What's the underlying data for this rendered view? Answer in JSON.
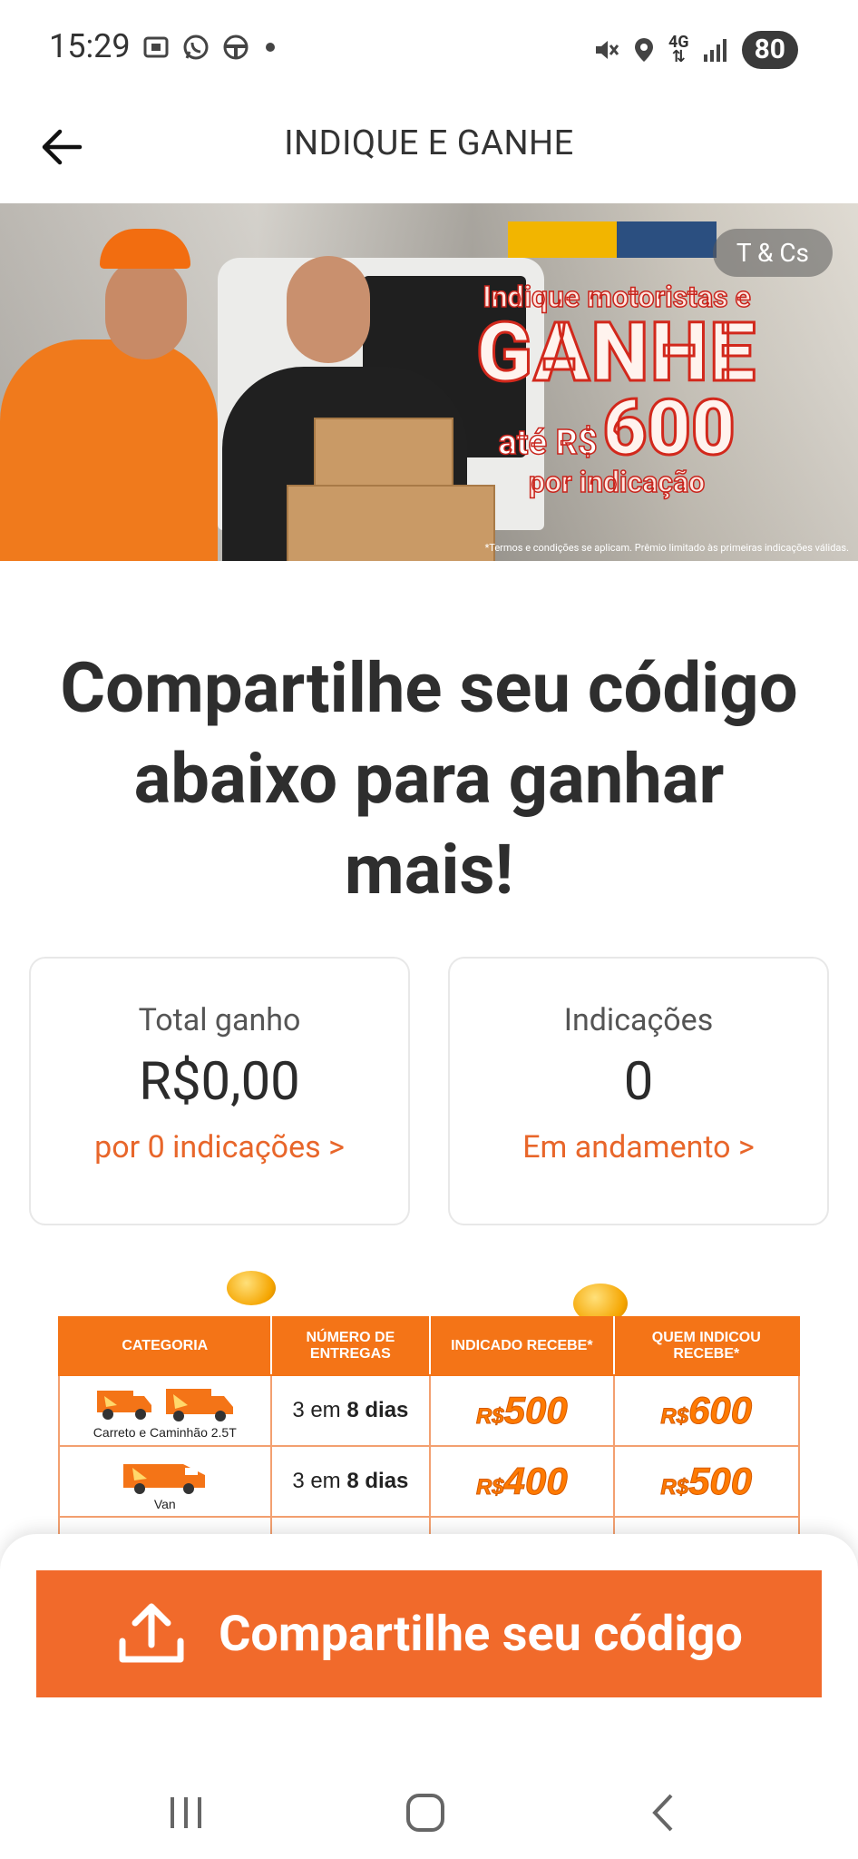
{
  "status_bar": {
    "time": "15:29",
    "battery": "80",
    "network": "4G",
    "left_icons": [
      "screenshot-icon",
      "whatsapp-icon",
      "steering-wheel-icon",
      "dot-icon"
    ],
    "right_icons": [
      "mute-icon",
      "location-icon",
      "network-4g-icon",
      "signal-icon",
      "battery-icon"
    ]
  },
  "app_bar": {
    "title": "INDIQUE E GANHE",
    "back_icon": "arrow-left-icon"
  },
  "banner": {
    "tcs_label": "T & Cs",
    "line1": "Indique motoristas e",
    "line2": "GANHE",
    "line3_prefix": "até R$",
    "line3_value": "600",
    "line4": "por indicação",
    "disclaimer": "*Termos e condições se aplicam. Prêmio limitado às primeiras indicações válidas."
  },
  "headline": "Compartilhe seu código abaixo para ganhar mais!",
  "stats": {
    "earned": {
      "label": "Total ganho",
      "value": "R$0,00",
      "link": "por 0 indicações >"
    },
    "referrals": {
      "label": "Indicações",
      "value": "0",
      "link": "Em andamento >"
    }
  },
  "table": {
    "headers": [
      "CATEGORIA",
      "NÚMERO DE ENTREGAS",
      "INDICADO RECEBE*",
      "QUEM INDICOU RECEBE*"
    ],
    "rows": [
      {
        "category": "Carreto e Caminhão 2.5T",
        "deliveries_prefix": "3 em",
        "deliveries_bold": "8 dias",
        "currency": "R$",
        "referred": "500",
        "referrer": "600"
      },
      {
        "category": "Van",
        "deliveries_prefix": "3 em",
        "deliveries_bold": "8 dias",
        "currency": "R$",
        "referred": "400",
        "referrer": "500"
      }
    ]
  },
  "share_button": {
    "label": "Compartilhe seu código",
    "icon": "upload-share-icon"
  },
  "nav": {
    "icons": [
      "recents-icon",
      "home-icon",
      "back-nav-icon"
    ]
  },
  "colors": {
    "accent": "#F16A2B",
    "table_header": "#F47417",
    "link": "#E8662A"
  }
}
